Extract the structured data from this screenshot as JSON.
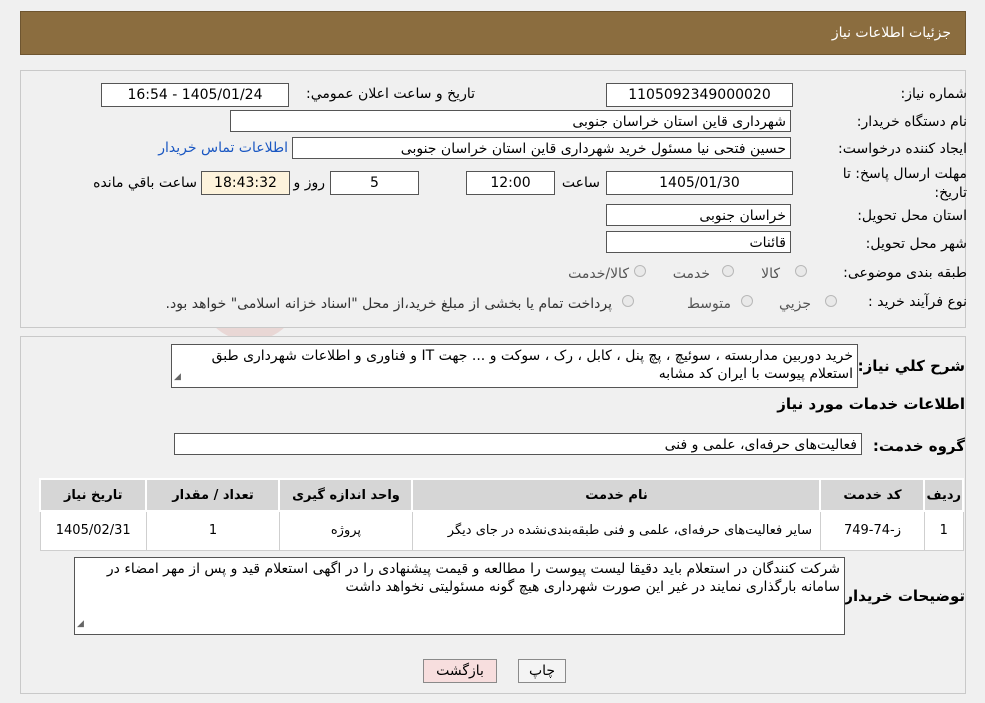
{
  "header": {
    "title": "جزئیات اطلاعات نیاز"
  },
  "form": {
    "need_number_label": "شماره نیاز:",
    "need_number": "1105092349000020",
    "announce_label": "تاریخ و ساعت اعلان عمومي:",
    "announce_value": "1405/01/24 - 16:54",
    "buyer_org_label": "نام دستگاه خريدار:",
    "buyer_org": "شهرداری قاین استان خراسان جنوبی",
    "creator_label": "ايجاد کننده درخواست:",
    "creator": "حسین فتحی نیا مسئول خرید شهرداری قاین استان خراسان جنوبی",
    "contact_link": "اطلاعات تماس خريدار",
    "deadline_label": "مهلت ارسال پاسخ: تا تاريخ:",
    "deadline_date": "1405/01/30",
    "time_label": "ساعت",
    "deadline_time": "12:00",
    "days_value": "5",
    "days_label": "روز و",
    "remaining_time": "18:43:32",
    "remaining_label": "ساعت باقي مانده",
    "province_label": "استان محل تحويل:",
    "province": "خراسان جنوبی",
    "city_label": "شهر محل تحويل:",
    "city": "قائنات",
    "category_label": "طبقه بندی موضوعی:",
    "category_options": [
      "كالا",
      "خدمت",
      "كالا/خدمت"
    ],
    "purchase_type_label": "نوع فرآيند خريد :",
    "purchase_options": [
      "جزيي",
      "متوسط"
    ],
    "purchase_note": "پرداخت تمام يا بخشی از مبلغ خريد،از محل \"اسناد خزانه اسلامی\" خواهد بود."
  },
  "need": {
    "summary_label": "شرح کلي نياز:",
    "summary_text": "خرید دوربین مداربسته ، سوئیچ ، پچ پنل ، کابل ، رک ، سوکت و ... جهت IT و فناوری و اطلاعات شهرداری طبق استعلام پیوست با ایران کد مشابه",
    "services_title": "اطلاعات خدمات مورد نياز",
    "service_group_label": "گروه خدمت:",
    "service_group": "فعالیت‌های حرفه‌ای، علمی و فنی"
  },
  "table": {
    "headers": [
      "رديف",
      "کد خدمت",
      "نام خدمت",
      "واحد اندازه گيری",
      "تعداد / مقدار",
      "تاريخ نياز"
    ],
    "rows": [
      [
        "1",
        "ز-74-749",
        "سایر فعالیت‌های حرفه‌ای، علمی و فنی طبقه‌بندی‌نشده در جای دیگر",
        "پروژه",
        "1",
        "1405/02/31"
      ]
    ]
  },
  "buyer_notes": {
    "label": "توضيحات خريدار:",
    "text": "شرکت کنندگان در استعلام باید دقیقا لیست پیوست را مطالعه و قیمت پیشنهادی را در اگهی استعلام قید و پس از مهر امضاء در سامانه بارگذاری نمایند در غیر این صورت شهرداری هیچ گونه مسئولیتی نخواهد داشت"
  },
  "buttons": {
    "print": "چاپ",
    "back": "بازگشت"
  },
  "watermark": {
    "text": "AriaTender.neT"
  },
  "colors": {
    "header": "#8b6d3f",
    "link": "#1a57c2",
    "back_button": "#f7dede",
    "time_box": "#fdf3dc"
  }
}
